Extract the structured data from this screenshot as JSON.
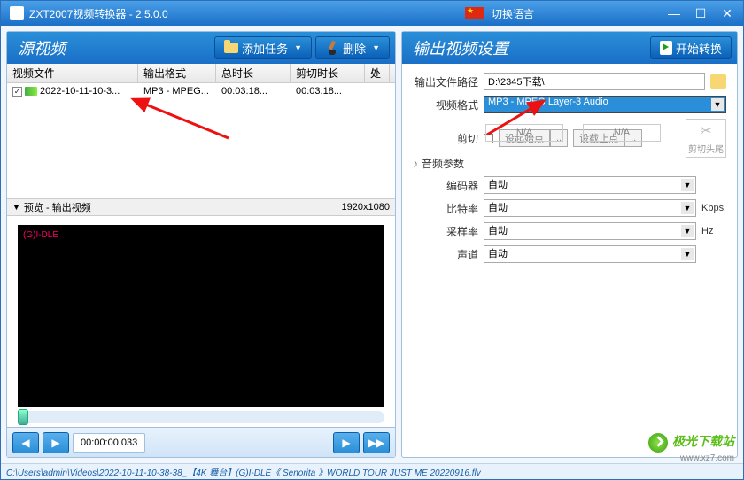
{
  "titlebar": {
    "app_title": "ZXT2007视频转换器 - 2.5.0.0",
    "lang_label": "切换语言"
  },
  "left": {
    "title": "源视频",
    "add_task": "添加任务",
    "delete": "删除",
    "cols": {
      "file": "视频文件",
      "fmt": "输出格式",
      "dur": "总时长",
      "trim": "剪切时长",
      "p": "处"
    },
    "row": {
      "file": "2022-10-11-10-3...",
      "fmt": "MP3 - MPEG...",
      "dur": "00:03:18...",
      "trim": "00:03:18..."
    },
    "preview_label": "预览 - 输出视频",
    "preview_res": "1920x1080",
    "preview_text1": "(G)I-DLE",
    "time": "00:00:00.033"
  },
  "right": {
    "title": "输出视频设置",
    "start": "开始转换",
    "labels": {
      "outpath": "输出文件路径",
      "vfmt": "视频格式",
      "trim": "剪切",
      "set_start": "设起始点",
      "set_end": "设截止点",
      "na": "N/A",
      "cut": "剪切头尾",
      "audio_section": "音频参数",
      "encoder": "编码器",
      "bitrate": "比特率",
      "samplerate": "采样率",
      "channel": "声道",
      "auto": "自动",
      "kbps": "Kbps",
      "hz": "Hz"
    },
    "vals": {
      "outpath": "D:\\2345下载\\",
      "vfmt": "MP3 - MPEG Layer-3 Audio"
    }
  },
  "statusbar": "C:\\Users\\admin\\Videos\\2022-10-11-10-38-38_【4K 舞台】(G)I-DLE《 Senorita 》WORLD TOUR JUST ME 20220916.flv",
  "watermark": {
    "name": "极光下载站",
    "url": "www.xz7.com"
  }
}
